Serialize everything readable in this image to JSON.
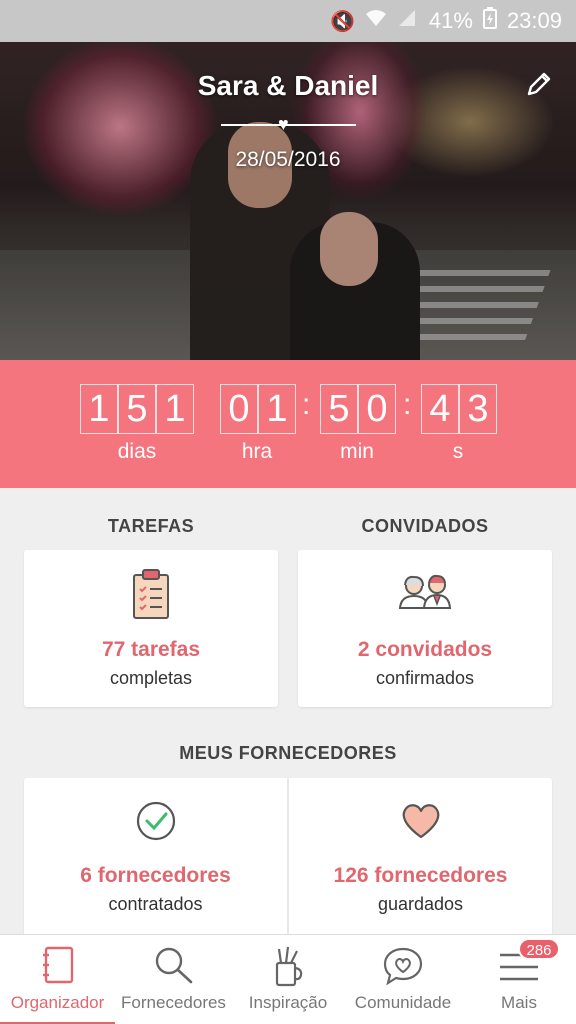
{
  "status_bar": {
    "battery_percent": "41%",
    "time": "23:09",
    "icons": [
      "mute-icon",
      "wifi-icon",
      "signal-icon",
      "battery-charging-icon"
    ]
  },
  "header": {
    "couple_names": "Sara & Daniel",
    "wedding_date": "28/05/2016",
    "edit_icon": "pencil-icon"
  },
  "countdown": {
    "days_digits": [
      "1",
      "5",
      "1"
    ],
    "hours_digits": [
      "0",
      "1"
    ],
    "minutes_digits": [
      "5",
      "0"
    ],
    "seconds_digits": [
      "4",
      "3"
    ],
    "labels": {
      "days": "dias",
      "hours": "hra",
      "minutes": "min",
      "seconds": "s"
    },
    "background_color": "#f4757e"
  },
  "tasks": {
    "title": "TAREFAS",
    "count_text": "77 tarefas",
    "sub_text": "completas",
    "icon": "clipboard-icon"
  },
  "guests": {
    "title": "CONVIDADOS",
    "count_text": "2 convidados",
    "sub_text": "confirmados",
    "icon": "guests-icon"
  },
  "vendors": {
    "title": "MEUS FORNECEDORES",
    "hired": {
      "count_text": "6 fornecedores",
      "sub_text": "contratados",
      "icon": "check-circle-icon"
    },
    "saved": {
      "count_text": "126 fornecedores",
      "sub_text": "guardados",
      "icon": "heart-icon"
    }
  },
  "bottom_nav": {
    "items": [
      {
        "label": "Organizador",
        "icon": "notebook-icon",
        "active": true
      },
      {
        "label": "Fornecedores",
        "icon": "search-icon",
        "active": false
      },
      {
        "label": "Inspiração",
        "icon": "pencil-cup-icon",
        "active": false
      },
      {
        "label": "Comunidade",
        "icon": "chat-heart-icon",
        "active": false
      },
      {
        "label": "Mais",
        "icon": "menu-icon",
        "active": false
      }
    ],
    "more_badge": "286"
  },
  "accent_color": "#e0676e"
}
